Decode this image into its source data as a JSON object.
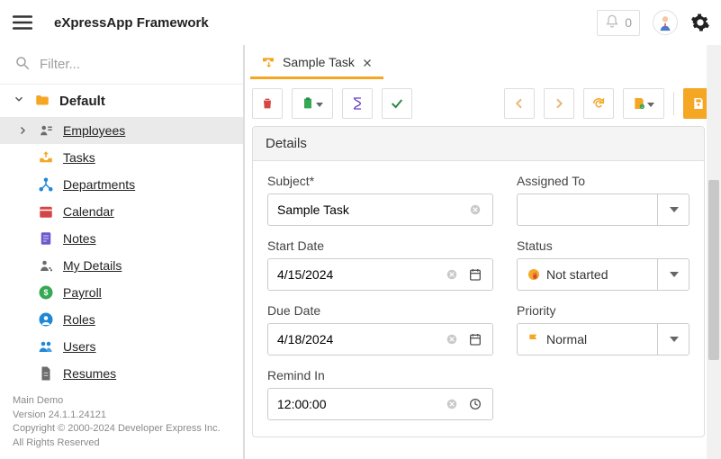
{
  "header": {
    "title": "eXpressApp Framework",
    "notification_count": "0"
  },
  "sidebar": {
    "filter_placeholder": "Filter...",
    "group_label": "Default",
    "items": [
      {
        "label": "Employees",
        "icon": "person-card",
        "color": "#6b6b6b",
        "active": true,
        "expandable": true
      },
      {
        "label": "Tasks",
        "icon": "task-tray",
        "color": "#f5a623"
      },
      {
        "label": "Departments",
        "icon": "nodes",
        "color": "#1f88d6"
      },
      {
        "label": "Calendar",
        "icon": "calendar",
        "color": "#d64545"
      },
      {
        "label": "Notes",
        "icon": "note",
        "color": "#6a5acd"
      },
      {
        "label": "My Details",
        "icon": "person-dots",
        "color": "#6b6b6b"
      },
      {
        "label": "Payroll",
        "icon": "dollar-circle",
        "color": "#34a853"
      },
      {
        "label": "Roles",
        "icon": "person-circle",
        "color": "#1f88d6"
      },
      {
        "label": "Users",
        "icon": "people",
        "color": "#1f88d6"
      },
      {
        "label": "Resumes",
        "icon": "document",
        "color": "#6b6b6b"
      }
    ],
    "footer": {
      "line1": "Main Demo",
      "line2": "Version 24.1.1.24121",
      "line3": "Copyright © 2000-2024 Developer Express Inc.",
      "line4": "All Rights Reserved"
    }
  },
  "tab": {
    "title": "Sample Task"
  },
  "panel": {
    "title": "Details"
  },
  "form": {
    "subject_label": "Subject*",
    "subject_value": "Sample Task",
    "assigned_label": "Assigned To",
    "assigned_value": "",
    "start_label": "Start Date",
    "start_value": "4/15/2024",
    "status_label": "Status",
    "status_value": "Not started",
    "due_label": "Due Date",
    "due_value": "4/18/2024",
    "priority_label": "Priority",
    "priority_value": "Normal",
    "remind_label": "Remind In",
    "remind_value": "12:00:00"
  }
}
